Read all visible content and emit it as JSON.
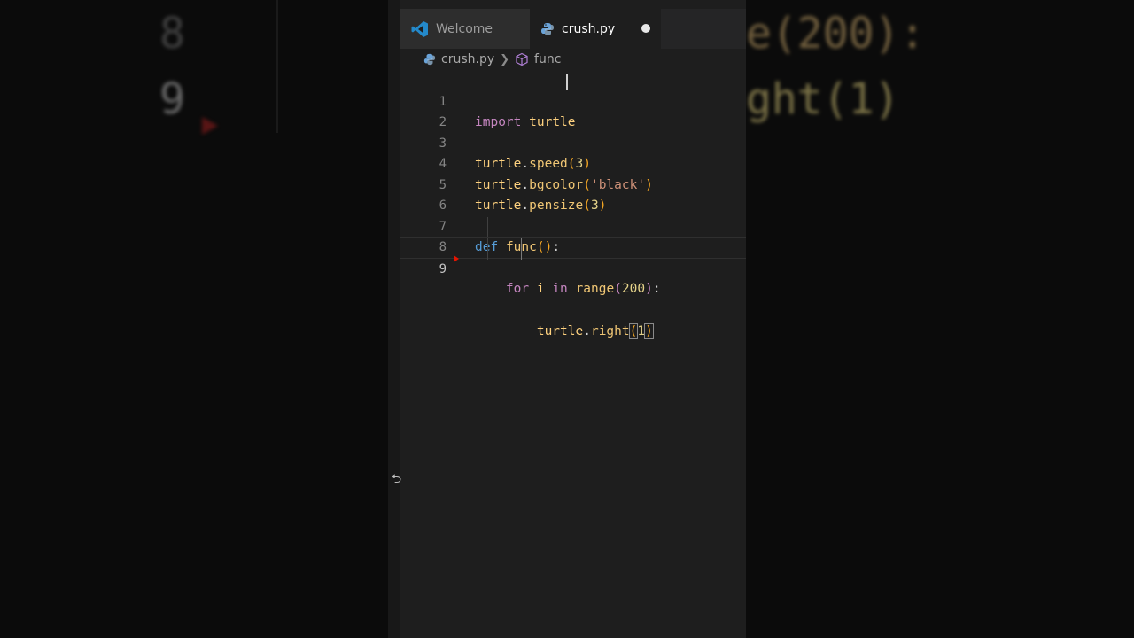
{
  "background": {
    "zoom_left_top": "8",
    "zoom_left_bottom": "9",
    "zoom_right_top": "e(200):",
    "zoom_right_bottom": "ght(1)"
  },
  "tabs": [
    {
      "label": "Welcome",
      "icon": "vscode-icon"
    },
    {
      "label": "crush.py",
      "icon": "python-icon",
      "dirty": true
    }
  ],
  "breadcrumb": {
    "file": "crush.py",
    "symbol": "func"
  },
  "code": {
    "lines": [
      {
        "n": "1"
      },
      {
        "n": "2"
      },
      {
        "n": "3"
      },
      {
        "n": "4"
      },
      {
        "n": "5"
      },
      {
        "n": "6"
      },
      {
        "n": "7"
      },
      {
        "n": "8"
      },
      {
        "n": "9"
      }
    ],
    "tokens": {
      "l1_kw": "import",
      "l1_id": "turtle",
      "l3_obj": "turtle",
      "l3_fn": "speed",
      "l3_num": "3",
      "l4_obj": "turtle",
      "l4_fn": "bgcolor",
      "l4_str": "'black'",
      "l5_obj": "turtle",
      "l5_fn": "pensize",
      "l5_num": "3",
      "l7_kw": "def",
      "l7_fn": "func",
      "l8_kw": "for",
      "l8_var": "i",
      "l8_in": "in",
      "l8_fn": "range",
      "l8_num": "200",
      "l9_obj": "turtle",
      "l9_fn": "right",
      "l9_num": "1"
    },
    "current_line": "9"
  },
  "colors": {
    "editor_bg": "#1e1e1e",
    "keyword": "#c586c0",
    "def_keyword": "#569cd6",
    "identifier": "#ffd27f",
    "string": "#ce9178",
    "error_marker": "#e51400"
  }
}
